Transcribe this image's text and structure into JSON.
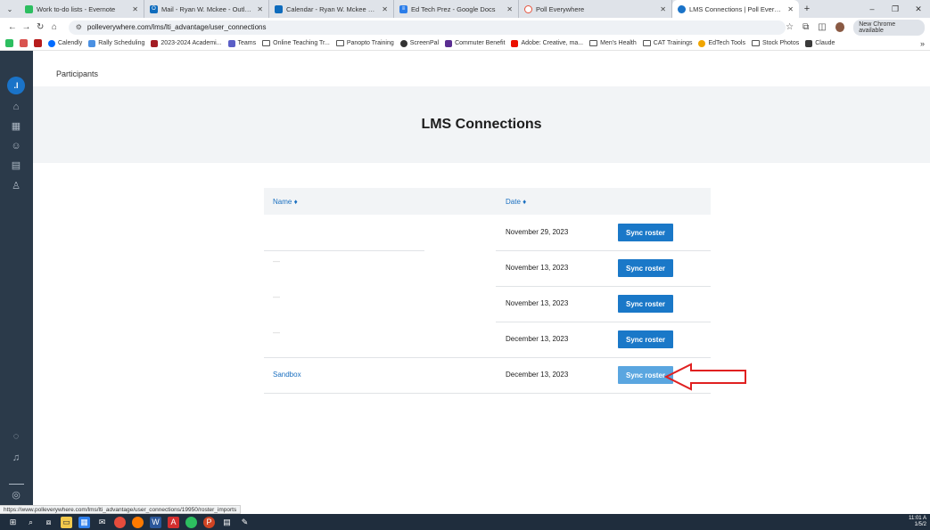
{
  "browser": {
    "tabs": [
      {
        "title": "Work to-do lists - Evernote",
        "fav_color": "#2dbe60"
      },
      {
        "title": "Mail - Ryan W. Mckee - Outloo",
        "fav_color": "#0f6cbd"
      },
      {
        "title": "Calendar - Ryan W. Mckee - Ou",
        "fav_color": "#0f6cbd"
      },
      {
        "title": "Ed Tech Prez - Google Docs",
        "fav_color": "#2b7de9"
      },
      {
        "title": "Poll Everywhere",
        "fav_color": "#e5533d"
      },
      {
        "title": "LMS Connections | Poll Everywh",
        "fav_color": "#1a73c8"
      }
    ],
    "url": "polleverywhere.com/lms/lti_advantage/user_connections",
    "chrome_available": "New Chrome available",
    "bookmarks": [
      {
        "label": "Calendly"
      },
      {
        "label": "Rally Scheduling"
      },
      {
        "label": "2023-2024 Academi..."
      },
      {
        "label": "Teams"
      },
      {
        "label": "Online Teaching Tr..."
      },
      {
        "label": "Panopto Training"
      },
      {
        "label": "ScreenPal"
      },
      {
        "label": "Commuter Benefit"
      },
      {
        "label": "Adobe: Creative, ma..."
      },
      {
        "label": "Men's Health"
      },
      {
        "label": "CAT Trainings"
      },
      {
        "label": "EdTech Tools"
      },
      {
        "label": "Stock Photos"
      },
      {
        "label": "Claude"
      }
    ],
    "status_url": "https://www.polleverywhere.com/lms/lti_advantage/user_connections/19950/roster_imports"
  },
  "app": {
    "header": {
      "participants": "Participants"
    },
    "page_title": "LMS Connections",
    "table": {
      "col_name": "Name ♦",
      "col_date": "Date ♦",
      "rows": [
        {
          "name": "",
          "date": "November 29, 2023",
          "action": "Sync roster"
        },
        {
          "name": "—",
          "date": "November 13, 2023",
          "action": "Sync roster"
        },
        {
          "name": "—",
          "date": "November 13, 2023",
          "action": "Sync roster"
        },
        {
          "name": "—",
          "date": "December 13, 2023",
          "action": "Sync roster"
        },
        {
          "name": "Sandbox",
          "date": "December 13, 2023",
          "action": "Sync roster"
        }
      ]
    }
  },
  "taskbar": {
    "time": "11:01 A",
    "date": "1/5/2"
  },
  "colors": {
    "accent": "#1a78c8",
    "sidebar": "#2b3a4a",
    "annotation_arrow": "#e02020"
  }
}
